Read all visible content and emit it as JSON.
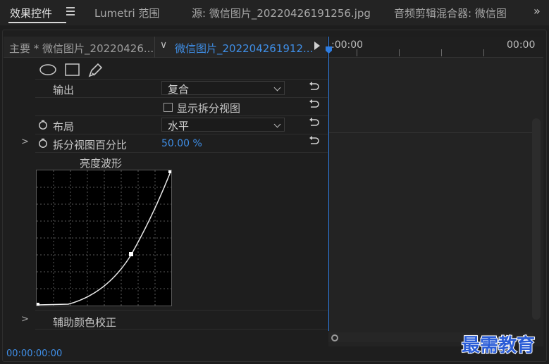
{
  "tabs": [
    {
      "label": "效果控件",
      "active": true
    },
    {
      "label": "Lumetri 范围",
      "active": false
    },
    {
      "label": "源: 微信图片_20220426191256.jpg",
      "active": false
    },
    {
      "label": "音频剪辑混合器: 微信图",
      "active": false
    }
  ],
  "tabs_more": "»",
  "clipbar": {
    "master_label": "主要 * 微信图片_20220426...",
    "sequence_label": "微信图片_202204261912...",
    "chevron": "∨"
  },
  "timeline": {
    "start_time": ":00:00",
    "end_time": "00:00"
  },
  "properties": {
    "output_label": "输出",
    "output_value": "复合",
    "show_split_label": "显示拆分视图",
    "layout_label": "布局",
    "layout_value": "水平",
    "split_percent_label": "拆分视图百分比",
    "split_percent_value": "50.00 %",
    "split_percent_fraction": 0.5
  },
  "waveform": {
    "title": "亮度波形"
  },
  "sections": {
    "auxiliary_label": "辅助颜色校正"
  },
  "bottom_time": "00:00:00:00",
  "watermark": "最需教育",
  "colors": {
    "accent": "#3f8ee6",
    "playhead": "#2e7de2",
    "background": "#1d1d1d"
  }
}
